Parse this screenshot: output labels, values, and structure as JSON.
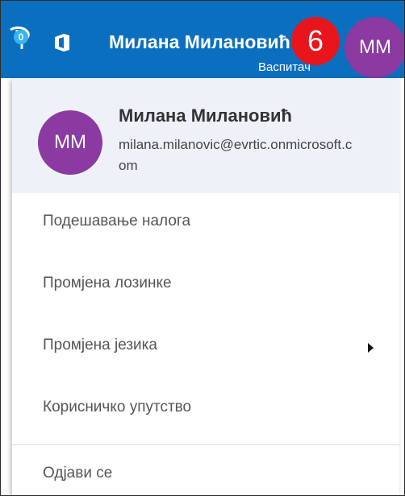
{
  "header": {
    "notification_count": "0",
    "user_name": "Милана Милановић",
    "user_role": "Васпитач",
    "step_badge": "6",
    "avatar_initials": "ММ",
    "bar_color": "#0b6fbf",
    "avatar_color": "#8b3aa1"
  },
  "profile": {
    "initials": "ММ",
    "name": "Милана Милановић",
    "email": "milana.milanovic@evrtic.onmicrosoft.com"
  },
  "menu": {
    "items": [
      {
        "label": "Подешавање налога",
        "icon": ""
      },
      {
        "label": "Промјена лозинке",
        "icon": ""
      },
      {
        "label": "Промјена језика",
        "icon": "chevron-right-icon"
      },
      {
        "label": "Корисничко упутство",
        "icon": ""
      },
      {
        "label": "Одјави се",
        "icon": ""
      }
    ]
  }
}
